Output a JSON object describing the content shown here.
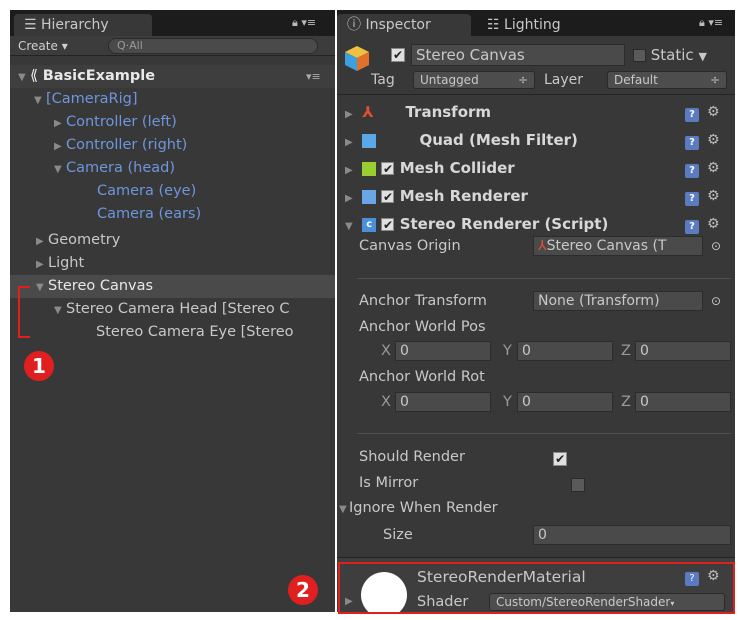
{
  "hierarchy": {
    "tab_label": "Hierarchy",
    "create_label": "Create",
    "search_placeholder": "All",
    "scene_name": "BasicExample",
    "items": [
      {
        "label": "[CameraRig]"
      },
      {
        "label": "Controller (left)"
      },
      {
        "label": "Controller (right)"
      },
      {
        "label": "Camera (head)"
      },
      {
        "label": "Camera (eye)"
      },
      {
        "label": "Camera (ears)"
      },
      {
        "label": "Geometry"
      },
      {
        "label": "Light"
      },
      {
        "label": "Stereo Canvas"
      },
      {
        "label": "Stereo Camera Head [Stereo C"
      },
      {
        "label": "Stereo Camera Eye [Stereo"
      }
    ]
  },
  "annotations": {
    "badge1": "1",
    "badge2": "2"
  },
  "inspector": {
    "tab_label": "Inspector",
    "lighting_tab_label": "Lighting",
    "object_name": "Stereo Canvas",
    "static_label": "Static",
    "tag_label": "Tag",
    "tag_value": "Untagged",
    "layer_label": "Layer",
    "layer_value": "Default",
    "components": [
      {
        "label": "Transform"
      },
      {
        "label": "Quad (Mesh Filter)"
      },
      {
        "label": "Mesh Collider"
      },
      {
        "label": "Mesh Renderer"
      },
      {
        "label": "Stereo Renderer (Script)"
      }
    ],
    "canvas_origin_label": "Canvas Origin",
    "canvas_origin_value": "Stereo Canvas (T",
    "anchor_transform_label": "Anchor Transform",
    "anchor_transform_value": "None (Transform)",
    "anchor_pos_label": "Anchor World Pos",
    "anchor_rot_label": "Anchor World Rot",
    "x_label": "X",
    "y_label": "Y",
    "z_label": "Z",
    "pos": {
      "x": "0",
      "y": "0",
      "z": "0"
    },
    "rot": {
      "x": "0",
      "y": "0",
      "z": "0"
    },
    "should_render_label": "Should Render",
    "is_mirror_label": "Is Mirror",
    "ignore_label": "Ignore When Render",
    "size_label": "Size",
    "size_value": "0",
    "material_name": "StereoRenderMaterial",
    "shader_label": "Shader",
    "shader_value": "Custom/StereoRenderShader"
  }
}
